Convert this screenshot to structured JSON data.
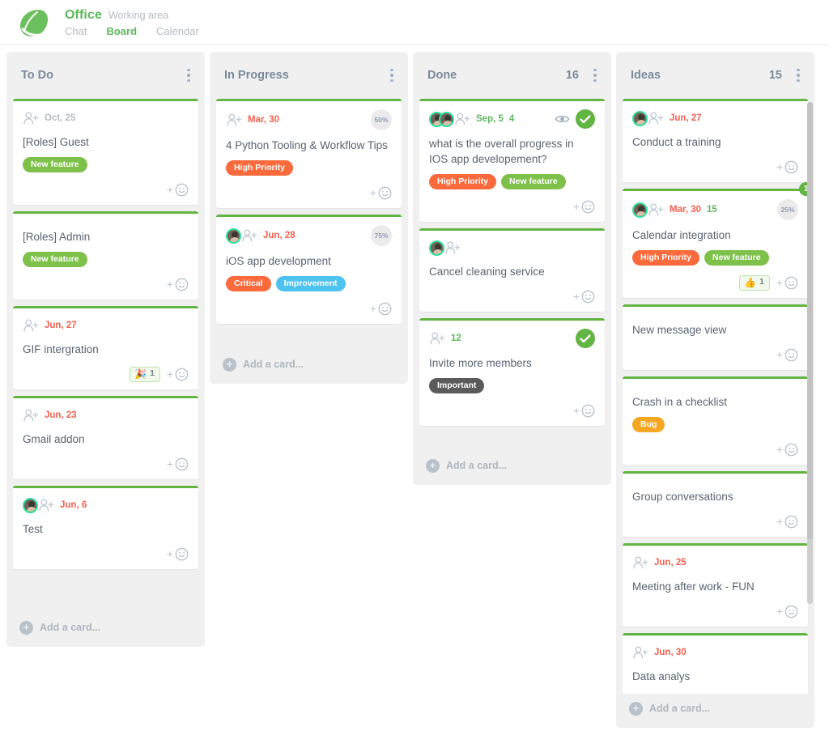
{
  "header": {
    "logo_icon": "leaf-planet-logo",
    "title": "Office",
    "subtitle": "Working area",
    "nav": [
      {
        "label": "Chat",
        "active": false
      },
      {
        "label": "Board",
        "active": true
      },
      {
        "label": "Calendar",
        "active": false
      }
    ]
  },
  "board": {
    "add_card_label": "Add a card...",
    "colors": {
      "accent_green": "#62b543",
      "brand_green": "#5cb85c",
      "high_priority": "#fa6a3c",
      "new_feature": "#7dc14a",
      "critical": "#fa6a3c",
      "improvement": "#4fc3f0",
      "bug": "#f5a623",
      "important": "#5b5b5b",
      "overdue_date": "#f4604f",
      "column_bg": "#f0f0f0"
    },
    "columns": [
      {
        "title": "To Do",
        "count": "",
        "cards": [
          {
            "title": "[Roles] Guest",
            "date": "Oct, 25",
            "date_state": "gray",
            "avatars": 0,
            "show_adduser": true,
            "tags": [
              {
                "label": "New feature",
                "color": "#7dc14a"
              }
            ]
          },
          {
            "title": "[Roles] Admin",
            "date": "",
            "date_state": "gray",
            "avatars": 0,
            "show_adduser": false,
            "tags": [
              {
                "label": "New feature",
                "color": "#7dc14a"
              }
            ]
          },
          {
            "title": "GIF intergration",
            "date": "Jun, 27",
            "date_state": "red",
            "avatars": 0,
            "show_adduser": true,
            "tags": [],
            "reaction": {
              "emoji": "🎉",
              "count": "1"
            }
          },
          {
            "title": "Gmail addon",
            "date": "Jun, 23",
            "date_state": "red",
            "avatars": 0,
            "show_adduser": true,
            "tags": []
          },
          {
            "title": "Test",
            "date": "Jun, 6",
            "date_state": "red",
            "avatars": 1,
            "show_adduser": true,
            "tags": []
          }
        ]
      },
      {
        "title": "In Progress",
        "count": "",
        "cards": [
          {
            "title": "4 Python Tooling & Workflow Tips",
            "date": "Mar, 30",
            "date_state": "red",
            "avatars": 0,
            "show_adduser": true,
            "progress": "50%",
            "tags": [
              {
                "label": "High Priority",
                "color": "#fa6a3c"
              }
            ]
          },
          {
            "title": "iOS app development",
            "date": "Jun, 28",
            "date_state": "red",
            "avatars": 1,
            "show_adduser": true,
            "progress": "75%",
            "tags": [
              {
                "label": "Critical",
                "color": "#fa6a3c"
              },
              {
                "label": "Improvement",
                "color": "#4fc3f0"
              }
            ]
          }
        ]
      },
      {
        "title": "Done",
        "count": "16",
        "cards": [
          {
            "title": "what is the overall progress in IOS app developement?",
            "date": "Sep, 5",
            "date_state": "green",
            "comments": "4",
            "watching": true,
            "completed": true,
            "avatars": 2,
            "show_adduser": true,
            "tags": [
              {
                "label": "High Priority",
                "color": "#fa6a3c"
              },
              {
                "label": "New feature",
                "color": "#7dc14a"
              }
            ]
          },
          {
            "title": "Cancel cleaning service",
            "date": "",
            "date_state": "gray",
            "avatars": 1,
            "show_adduser": true,
            "tags": []
          },
          {
            "title": "Invite more members",
            "date": "",
            "date_state": "gray",
            "comments": "12",
            "completed": true,
            "avatars": 0,
            "show_adduser": true,
            "tags": [
              {
                "label": "Important",
                "color": "#5b5b5b"
              }
            ]
          }
        ]
      },
      {
        "title": "Ideas",
        "count": "15",
        "cards": [
          {
            "title": "Conduct a training",
            "date": "Jun, 27",
            "date_state": "red",
            "avatars": 1,
            "show_adduser": true,
            "tags": []
          },
          {
            "title": "Calendar integration",
            "date": "Mar, 30",
            "date_state": "red",
            "comments": "15",
            "progress": "25%",
            "notify": "1",
            "avatars": 1,
            "show_adduser": true,
            "tags": [
              {
                "label": "High Priority",
                "color": "#fa6a3c"
              },
              {
                "label": "New feature",
                "color": "#7dc14a"
              }
            ],
            "reaction": {
              "emoji": "👍",
              "count": "1"
            }
          },
          {
            "title": "New message view",
            "date": "",
            "date_state": "gray",
            "avatars": 0,
            "show_adduser": false,
            "tags": []
          },
          {
            "title": "Crash in a checklist",
            "date": "",
            "date_state": "gray",
            "avatars": 0,
            "show_adduser": false,
            "tags": [
              {
                "label": "Bug",
                "color": "#f5a623"
              }
            ]
          },
          {
            "title": "Group conversations",
            "date": "",
            "date_state": "gray",
            "avatars": 0,
            "show_adduser": false,
            "tags": []
          },
          {
            "title": "Meeting after work - FUN",
            "date": "Jun, 25",
            "date_state": "red",
            "avatars": 0,
            "show_adduser": true,
            "tags": []
          },
          {
            "title": "Data analys",
            "date": "Jun, 30",
            "date_state": "red",
            "avatars": 0,
            "show_adduser": true,
            "tags": []
          }
        ]
      }
    ]
  }
}
